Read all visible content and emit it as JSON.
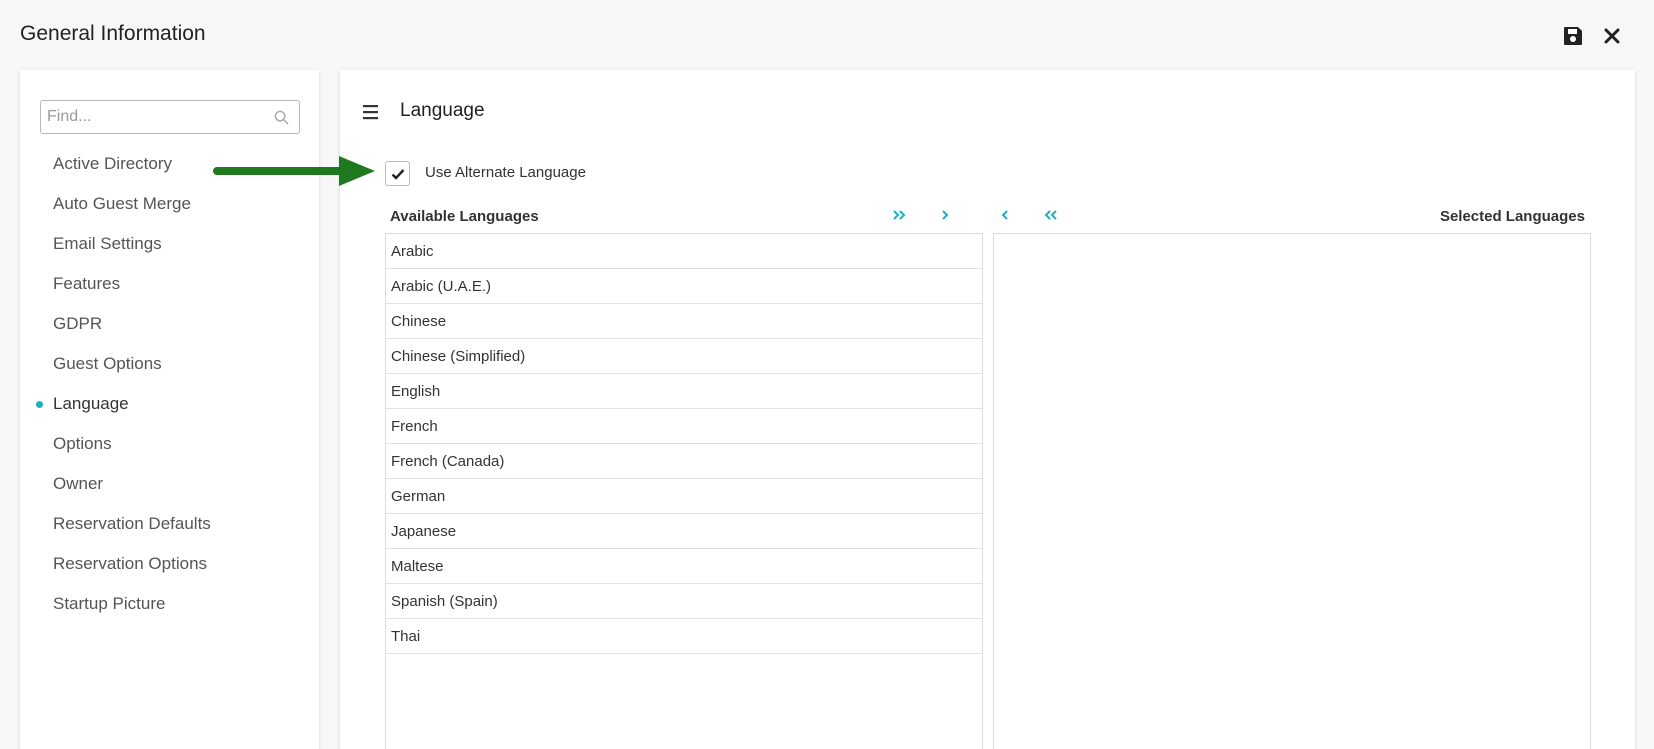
{
  "header": {
    "title": "General Information",
    "save_icon": "save-icon",
    "close_icon": "close-icon"
  },
  "sidebar": {
    "search_placeholder": "Find...",
    "search_value": "",
    "items": [
      {
        "label": "Active Directory"
      },
      {
        "label": "Auto Guest Merge"
      },
      {
        "label": "Email Settings"
      },
      {
        "label": "Features"
      },
      {
        "label": "GDPR"
      },
      {
        "label": "Guest Options"
      },
      {
        "label": "Language",
        "active": true
      },
      {
        "label": "Options"
      },
      {
        "label": "Owner"
      },
      {
        "label": "Reservation Defaults"
      },
      {
        "label": "Reservation Options"
      },
      {
        "label": "Startup Picture"
      }
    ]
  },
  "main": {
    "title": "Language",
    "use_alternate": {
      "label": "Use Alternate Language",
      "checked": true
    },
    "available_header": "Available Languages",
    "selected_header": "Selected Languages",
    "available": [
      "Arabic",
      "Arabic (U.A.E.)",
      "Chinese",
      "Chinese (Simplified)",
      "English",
      "French",
      "French (Canada)",
      "German",
      "Japanese",
      "Maltese",
      "Spanish (Spain)",
      "Thai"
    ],
    "selected": []
  },
  "colors": {
    "accent": "#1bb0c8",
    "annotation_arrow": "#1f7a1f"
  }
}
